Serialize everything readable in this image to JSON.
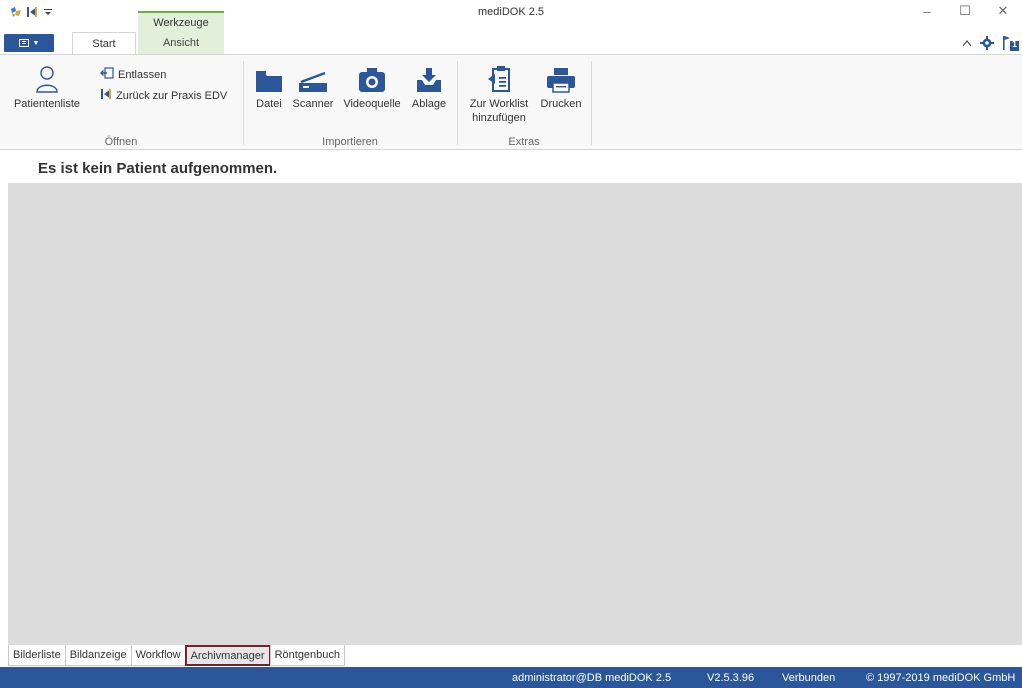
{
  "app": {
    "title": "mediDOK 2.5"
  },
  "window_controls": {
    "minimize": "–",
    "maximize": "☐",
    "close": "✕"
  },
  "tabs": {
    "start": "Start",
    "context_group": "Werkzeuge",
    "ansicht": "Ansicht"
  },
  "ribbon": {
    "oeffnen": {
      "label": "Öffnen",
      "patientenliste": "Patientenliste",
      "entlassen": "Entlassen",
      "zurueck": "Zurück zur Praxis EDV"
    },
    "importieren": {
      "label": "Importieren",
      "datei": "Datei",
      "scanner": "Scanner",
      "videoquelle": "Videoquelle",
      "ablage": "Ablage"
    },
    "extras": {
      "label": "Extras",
      "worklist_line1": "Zur Worklist",
      "worklist_line2": "hinzufügen",
      "drucken": "Drucken"
    }
  },
  "patient_header": {
    "message": "Es ist kein Patient aufgenommen."
  },
  "bottom_tabs": [
    {
      "label": "Bilderliste",
      "active": false
    },
    {
      "label": "Bildanzeige",
      "active": false
    },
    {
      "label": "Workflow",
      "active": false
    },
    {
      "label": "Archivmanager",
      "active": true
    },
    {
      "label": "Röntgenbuch",
      "active": false
    }
  ],
  "statusbar": {
    "user": "administrator@DB mediDOK 2.5",
    "version": "V2.5.3.96",
    "connection": "Verbunden",
    "copyright": "© 1997-2019 mediDOK GmbH"
  },
  "icons": {
    "flag_count": "1"
  },
  "colors": {
    "accent_blue": "#2b579a",
    "context_green": "#70ad47",
    "context_bg": "#e2efda",
    "active_tab_border": "#7a1f2e",
    "content_bg": "#dcdcdc"
  }
}
